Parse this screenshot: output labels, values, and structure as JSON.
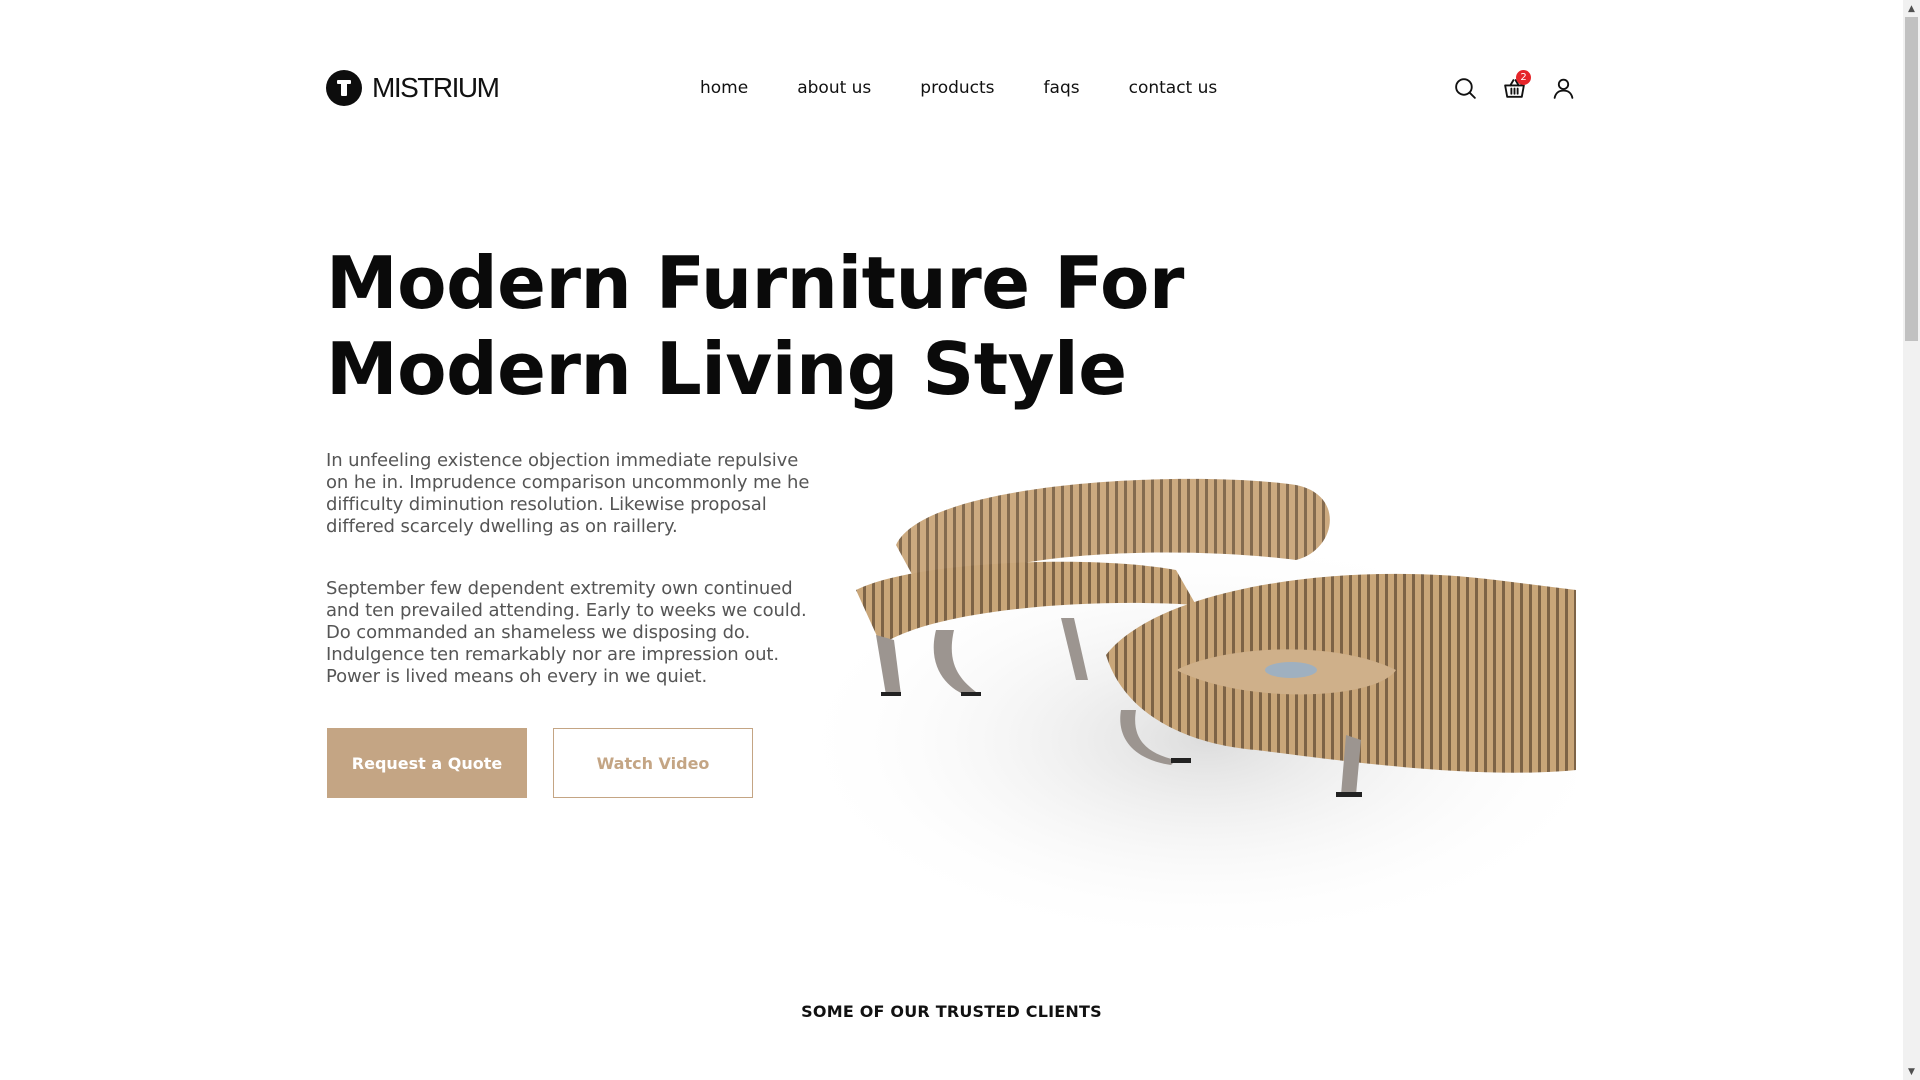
{
  "brand": {
    "name": "MISTRIUM",
    "logo_icon": "logo-t-mark"
  },
  "nav": {
    "items": [
      {
        "label": "home"
      },
      {
        "label": "about us"
      },
      {
        "label": "products"
      },
      {
        "label": "faqs"
      },
      {
        "label": "contact us"
      }
    ]
  },
  "header_icons": {
    "search": "search-icon",
    "cart": "basket-icon",
    "cart_count": "2",
    "account": "user-icon"
  },
  "hero": {
    "title_line1": "Modern Furniture For",
    "title_line2": "Modern Living Style",
    "paragraph1": "In unfeeling existence objection immediate repulsive on he in. Imprudence comparison uncommonly me he difficulty diminution resolution. Likewise proposal differed scarcely dwelling as on raillery.",
    "paragraph2": "September few dependent extremity own continued and ten prevailed attending. Early to weeks we could. Do commanded an shameless we disposing do. Indulgence ten remarkably nor are impression out. Power is lived means oh every in we quiet.",
    "primary_button": "Request a Quote",
    "secondary_button": "Watch Video"
  },
  "clients": {
    "title": "SOME OF OUR TRUSTED CLIENTS"
  },
  "colors": {
    "accent": "#c4a584",
    "badge": "#e5252a",
    "text": "#111111",
    "muted_text": "#555555"
  }
}
